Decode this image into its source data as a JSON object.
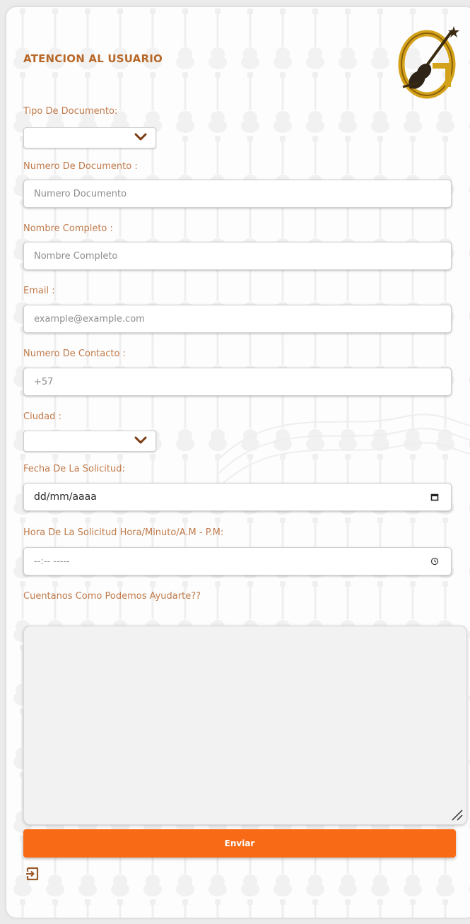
{
  "form": {
    "title": "ATENCION AL USUARIO",
    "logo_icon": "guitar-logo-icon",
    "fields": {
      "tipo_documento": {
        "label": "Tipo De Documento:",
        "value": ""
      },
      "numero_documento": {
        "label": "Numero De Documento :",
        "placeholder": "Numero Documento"
      },
      "nombre_completo": {
        "label": "Nombre Completo :",
        "placeholder": "Nombre Completo"
      },
      "email": {
        "label": "Email :",
        "placeholder": "example@example.com"
      },
      "numero_contacto": {
        "label": "Numero De Contacto :",
        "value": "+57"
      },
      "ciudad": {
        "label": "Ciudad :",
        "value": ""
      },
      "fecha": {
        "label": "Fecha De La Solicitud:",
        "placeholder": "dd/mm/aaaa"
      },
      "hora": {
        "label": "Hora De La Solicitud Hora/Minuto/A.M - P.M:",
        "placeholder": "--:-- -----"
      },
      "mensaje": {
        "label": "Cuentanos Como Podemos Ayudarte??",
        "value": ""
      }
    },
    "submit_label": "Enviar",
    "exit_icon": "exit-icon"
  },
  "colors": {
    "accent": "#f86a15",
    "label": "#c07a4a",
    "title": "#b8692a",
    "logo_gold": "#d4a21a"
  }
}
